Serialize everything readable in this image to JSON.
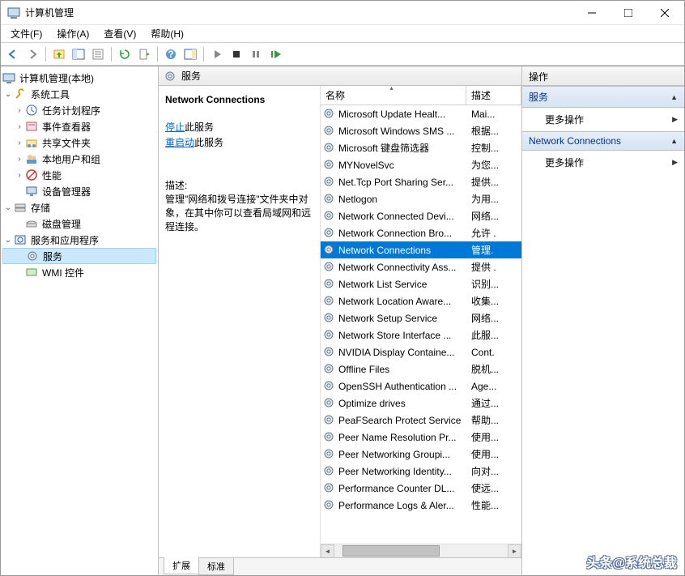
{
  "window": {
    "title": "计算机管理"
  },
  "menu": {
    "file": "文件(F)",
    "action": "操作(A)",
    "view": "查看(V)",
    "help": "帮助(H)"
  },
  "tree": {
    "root": "计算机管理(本地)",
    "system_tools": "系统工具",
    "task_scheduler": "任务计划程序",
    "event_viewer": "事件查看器",
    "shared_folders": "共享文件夹",
    "local_users": "本地用户和组",
    "performance": "性能",
    "device_manager": "设备管理器",
    "storage": "存储",
    "disk_mgmt": "磁盘管理",
    "services_apps": "服务和应用程序",
    "services": "服务",
    "wmi": "WMI 控件"
  },
  "middle": {
    "header": "服务",
    "selected_title": "Network Connections",
    "stop_link": "停止",
    "stop_suffix": "此服务",
    "restart_link": "重启动",
    "restart_suffix": "此服务",
    "desc_label": "描述:",
    "desc_text": "管理\"网络和拨号连接\"文件夹中对象，在其中你可以查看局域网和远程连接。"
  },
  "columns": {
    "name": "名称",
    "desc": "描述"
  },
  "services": [
    {
      "name": "Microsoft Update Healt...",
      "desc": "Mai..."
    },
    {
      "name": "Microsoft Windows SMS ...",
      "desc": "根据..."
    },
    {
      "name": "Microsoft 键盘筛选器",
      "desc": "控制..."
    },
    {
      "name": "MYNovelSvc",
      "desc": "为您..."
    },
    {
      "name": "Net.Tcp Port Sharing Ser...",
      "desc": "提供..."
    },
    {
      "name": "Netlogon",
      "desc": "为用..."
    },
    {
      "name": "Network Connected Devi...",
      "desc": "网络..."
    },
    {
      "name": "Network Connection Bro...",
      "desc": "允许 ."
    },
    {
      "name": "Network Connections",
      "desc": "管理.",
      "selected": true
    },
    {
      "name": "Network Connectivity Ass...",
      "desc": "提供 ."
    },
    {
      "name": "Network List Service",
      "desc": "识别..."
    },
    {
      "name": "Network Location Aware...",
      "desc": "收集..."
    },
    {
      "name": "Network Setup Service",
      "desc": "网络..."
    },
    {
      "name": "Network Store Interface ...",
      "desc": "此服..."
    },
    {
      "name": "NVIDIA Display Containe...",
      "desc": "Cont."
    },
    {
      "name": "Offline Files",
      "desc": "脱机..."
    },
    {
      "name": "OpenSSH Authentication ...",
      "desc": "Age..."
    },
    {
      "name": "Optimize drives",
      "desc": "通过..."
    },
    {
      "name": "PeaFSearch Protect Service",
      "desc": "帮助..."
    },
    {
      "name": "Peer Name Resolution Pr...",
      "desc": "使用..."
    },
    {
      "name": "Peer Networking Groupi...",
      "desc": "使用..."
    },
    {
      "name": "Peer Networking Identity...",
      "desc": "向对..."
    },
    {
      "name": "Performance Counter DL...",
      "desc": "使远..."
    },
    {
      "name": "Performance Logs & Aler...",
      "desc": "性能..."
    }
  ],
  "tabs": {
    "extended": "扩展",
    "standard": "标准"
  },
  "actions": {
    "header": "操作",
    "section1": "服务",
    "more1": "更多操作",
    "section2": "Network Connections",
    "more2": "更多操作"
  },
  "watermark": "头条@系统总裁"
}
